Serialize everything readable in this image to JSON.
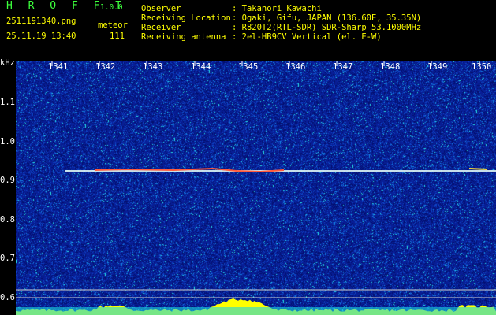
{
  "header": {
    "logo": "H R O F F T",
    "version": "1.0.0",
    "filename": "2511191340.png",
    "mode": "meteor",
    "datetime": "25.11.19 13:40",
    "count": "111"
  },
  "info": {
    "labels": [
      "Observer",
      "Receiving Location",
      "Receiver",
      "Receiving antenna"
    ],
    "values": [
      ": Takanori Kawachi",
      ": Ogaki, Gifu, JAPAN (136.60E, 35.35N)",
      ": R820T2(RTL-SDR) SDR-Sharp 53.1000MHz",
      ": 2el-HB9CV Vertical (el. E-W)"
    ]
  },
  "axis": {
    "y_unit": "kHz",
    "y_ticks": [
      "1.1",
      "1.0",
      "0.9",
      "0.8",
      "0.7",
      "0.6"
    ],
    "x_ticks": [
      "1341",
      "1342",
      "1343",
      "1344",
      "1345",
      "1346",
      "1347",
      "1348",
      "1349",
      "1350"
    ]
  },
  "colors": {
    "background": "#000000",
    "spectrum_base": "#0a1f9e",
    "trace": "#ffffff",
    "level_bar": "#ffff00",
    "header_green": "#3cff3c",
    "header_yellow": "#ffff00"
  }
}
